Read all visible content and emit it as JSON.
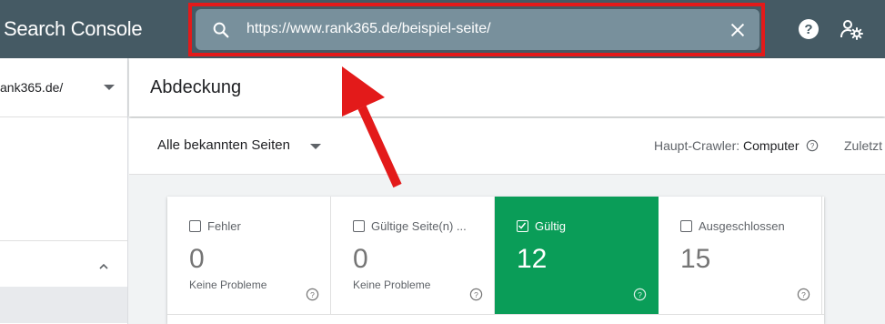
{
  "app": {
    "title": "Search Console"
  },
  "search": {
    "value": "https://www.rank365.de/beispiel-seite/"
  },
  "sidebar": {
    "property": "ank365.de/"
  },
  "page": {
    "title": "Abdeckung"
  },
  "filter": {
    "selected": "Alle bekannten Seiten",
    "crawler_label": "Haupt-Crawler:",
    "crawler_value": "Computer",
    "last_update": "Zuletzt"
  },
  "cards": [
    {
      "label": "Fehler",
      "count": "0",
      "sub": "Keine Probleme",
      "checked": false
    },
    {
      "label": "Gültige Seite(n) ...",
      "count": "0",
      "sub": "Keine Probleme",
      "checked": false
    },
    {
      "label": "Gültig",
      "count": "12",
      "sub": "",
      "checked": true
    },
    {
      "label": "Ausgeschlossen",
      "count": "15",
      "sub": "",
      "checked": false
    }
  ],
  "colors": {
    "topbar": "#455a64",
    "search_box": "#78909c",
    "highlight_frame": "#e31a1a",
    "valid_card": "#0a9d58"
  },
  "icons": [
    "search-icon",
    "close-icon",
    "help-icon",
    "admin-settings-icon",
    "chevron-up-icon",
    "help-outline-icon",
    "checkbox-icon"
  ]
}
